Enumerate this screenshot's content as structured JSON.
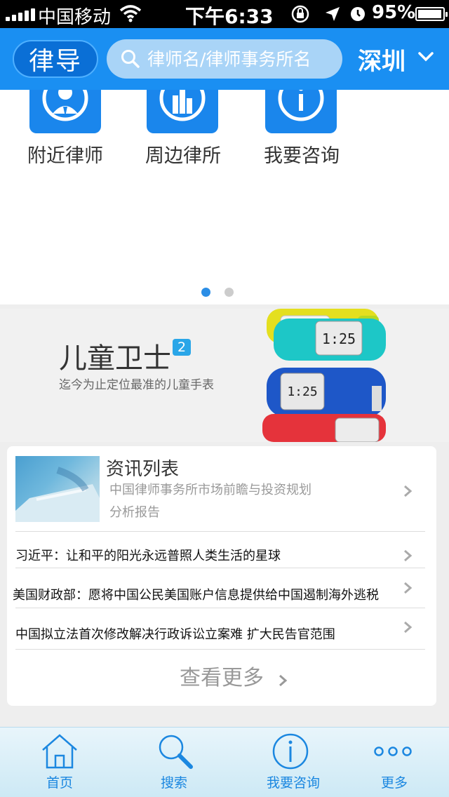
{
  "status_bar": {
    "carrier": "中国移动",
    "time": "下午6:33",
    "battery": "95%",
    "battery_level": 0.95
  },
  "nav": {
    "logo": "律导",
    "search_placeholder": "律师名/律师事务所名",
    "city": "深圳"
  },
  "quick_actions": [
    {
      "label": "附近律师",
      "icon": "lawyer-icon"
    },
    {
      "label": "周边律所",
      "icon": "building-icon"
    },
    {
      "label": "我要咨询",
      "icon": "info-icon"
    }
  ],
  "pager": {
    "count": 2,
    "active": 0
  },
  "banner": {
    "title": "儿童卫士",
    "badge": "2",
    "subtitle": "迄今为止定位最准的儿童手表"
  },
  "news": {
    "title": "资讯列表",
    "featured_line1": "中国律师事务所市场前瞻与投资规划",
    "featured_line2": "分析报告",
    "items": [
      "习近平：让和平的阳光永远普照人类生活的星球",
      "美国财政部：愿将中国公民美国账户信息提供给中国遏制海外逃税",
      "中国拟立法首次修改解决行政诉讼立案难  扩大民告官范围"
    ],
    "more_label": "查看更多"
  },
  "tabs": [
    {
      "label": "首页",
      "icon": "home-icon"
    },
    {
      "label": "搜索",
      "icon": "search-icon"
    },
    {
      "label": "我要咨询",
      "icon": "info-icon"
    },
    {
      "label": "更多",
      "icon": "more-icon"
    }
  ],
  "colors": {
    "brand": "#1a8ff2",
    "tab_text": "#1b87e0",
    "pager_active": "#2b8ee6",
    "pager_inactive": "#cccccc"
  }
}
